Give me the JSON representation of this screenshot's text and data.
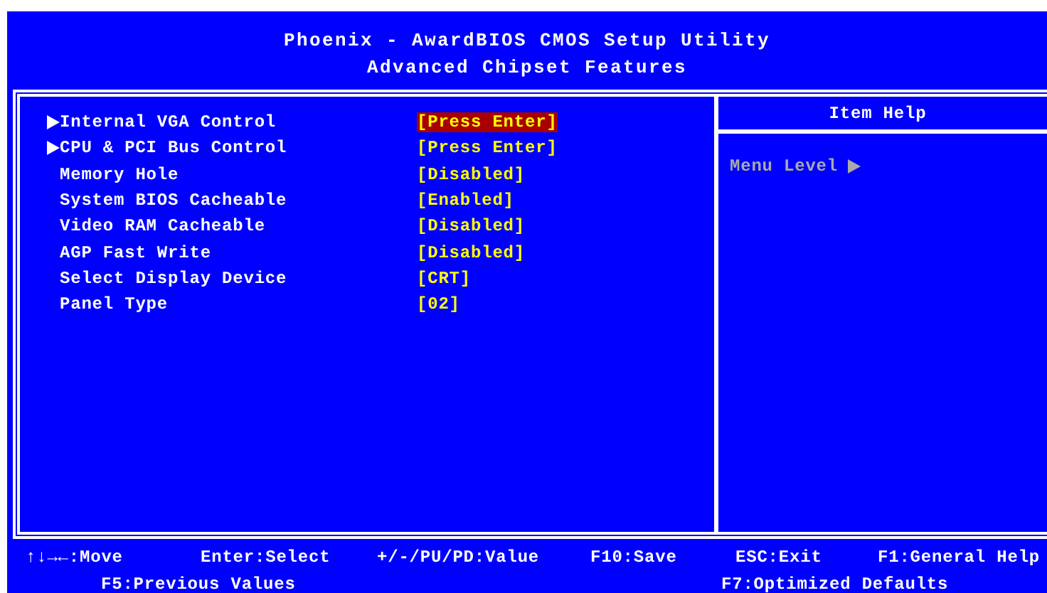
{
  "header": {
    "title": "Phoenix - AwardBIOS CMOS Setup Utility",
    "subtitle": "Advanced Chipset Features"
  },
  "items": [
    {
      "label": "Internal VGA Control",
      "value": "[Press Enter]",
      "submenu": true,
      "selected": true
    },
    {
      "label": "CPU & PCI Bus Control",
      "value": "[Press Enter]",
      "submenu": true,
      "selected": false
    },
    {
      "label": "Memory Hole",
      "value": "[Disabled]",
      "submenu": false,
      "selected": false
    },
    {
      "label": "System BIOS Cacheable",
      "value": "[Enabled]",
      "submenu": false,
      "selected": false
    },
    {
      "label": "Video RAM Cacheable",
      "value": "[Disabled]",
      "submenu": false,
      "selected": false
    },
    {
      "label": "AGP Fast Write",
      "value": "[Disabled]",
      "submenu": false,
      "selected": false
    },
    {
      "label": "Select Display Device",
      "value": "[CRT]",
      "submenu": false,
      "selected": false
    },
    {
      "label": "Panel Type",
      "value": "[02]",
      "submenu": false,
      "selected": false
    }
  ],
  "help": {
    "title": "Item Help",
    "menu_level": "Menu Level"
  },
  "footer": {
    "row_1": [
      "↑↓→←:Move",
      "Enter:Select",
      "+/-/PU/PD:Value",
      "F10:Save",
      "ESC:Exit",
      "F1:General Help"
    ],
    "row_2": [
      "F5:Previous Values",
      "F7:Optimized Defaults"
    ]
  }
}
